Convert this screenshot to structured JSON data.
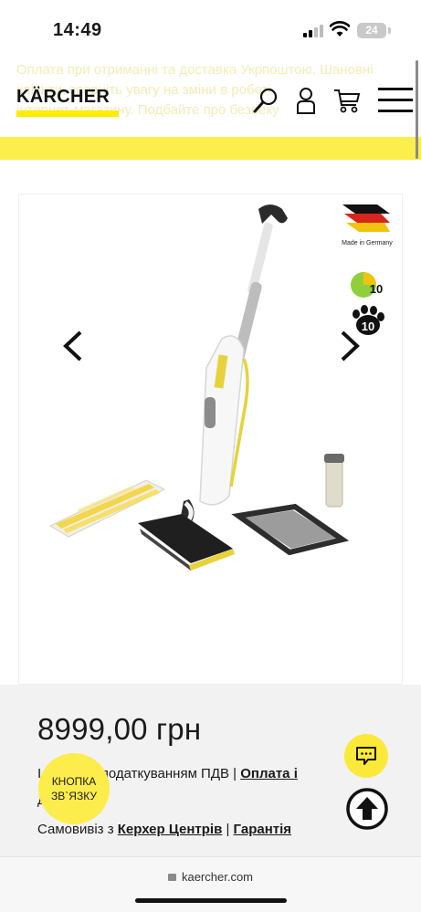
{
  "status_bar": {
    "time": "14:49",
    "battery": "24"
  },
  "header": {
    "logo": "KÄRCHER",
    "banner_text": "Оплата при отриманні та доставка Укрпоштою. Шановні\nклієнти, зверніть увагу на зміни в роботі\nінтернет-магазину. Подбайте про безпеку",
    "icons": [
      "search-icon",
      "user-icon",
      "cart-icon",
      "menu-icon"
    ]
  },
  "gallery": {
    "badge_label": "Made in Germany",
    "rating_a": "10",
    "rating_b": "10",
    "nav": [
      "prev-arrow-icon",
      "next-arrow-icon"
    ]
  },
  "product": {
    "price": "8999,00 грн",
    "tax_text_before": "І",
    "tax_text": "з оподаткуванням ПДВ |",
    "tax_link": "Оплата і",
    "tax_line2": "д",
    "pickup_prefix": "Самовивіз з",
    "pickup_link": "Керхер Центрів",
    "separator": "|",
    "warranty_link": "Гарантія"
  },
  "contact_bubble": {
    "line1": "КНОПКА",
    "line2": "ЗВ`ЯЗКУ"
  },
  "browser": {
    "url": "kaercher.com"
  },
  "colors": {
    "brand_yellow": "#ffed00",
    "band_yellow": "#fcee4b",
    "info_bg": "#f2f2f2"
  }
}
